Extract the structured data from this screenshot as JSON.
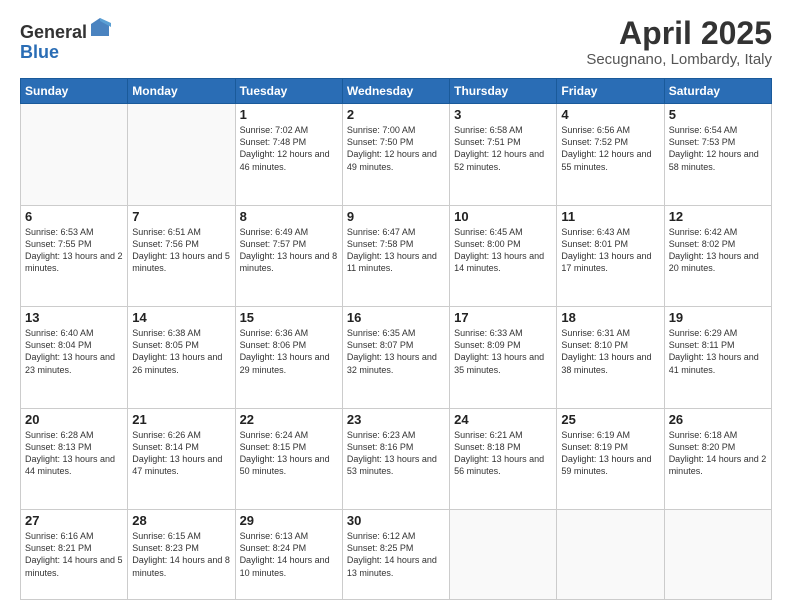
{
  "logo": {
    "general": "General",
    "blue": "Blue"
  },
  "title": "April 2025",
  "subtitle": "Secugnano, Lombardy, Italy",
  "weekdays": [
    "Sunday",
    "Monday",
    "Tuesday",
    "Wednesday",
    "Thursday",
    "Friday",
    "Saturday"
  ],
  "weeks": [
    [
      {
        "day": "",
        "info": ""
      },
      {
        "day": "",
        "info": ""
      },
      {
        "day": "1",
        "info": "Sunrise: 7:02 AM\nSunset: 7:48 PM\nDaylight: 12 hours and 46 minutes."
      },
      {
        "day": "2",
        "info": "Sunrise: 7:00 AM\nSunset: 7:50 PM\nDaylight: 12 hours and 49 minutes."
      },
      {
        "day": "3",
        "info": "Sunrise: 6:58 AM\nSunset: 7:51 PM\nDaylight: 12 hours and 52 minutes."
      },
      {
        "day": "4",
        "info": "Sunrise: 6:56 AM\nSunset: 7:52 PM\nDaylight: 12 hours and 55 minutes."
      },
      {
        "day": "5",
        "info": "Sunrise: 6:54 AM\nSunset: 7:53 PM\nDaylight: 12 hours and 58 minutes."
      }
    ],
    [
      {
        "day": "6",
        "info": "Sunrise: 6:53 AM\nSunset: 7:55 PM\nDaylight: 13 hours and 2 minutes."
      },
      {
        "day": "7",
        "info": "Sunrise: 6:51 AM\nSunset: 7:56 PM\nDaylight: 13 hours and 5 minutes."
      },
      {
        "day": "8",
        "info": "Sunrise: 6:49 AM\nSunset: 7:57 PM\nDaylight: 13 hours and 8 minutes."
      },
      {
        "day": "9",
        "info": "Sunrise: 6:47 AM\nSunset: 7:58 PM\nDaylight: 13 hours and 11 minutes."
      },
      {
        "day": "10",
        "info": "Sunrise: 6:45 AM\nSunset: 8:00 PM\nDaylight: 13 hours and 14 minutes."
      },
      {
        "day": "11",
        "info": "Sunrise: 6:43 AM\nSunset: 8:01 PM\nDaylight: 13 hours and 17 minutes."
      },
      {
        "day": "12",
        "info": "Sunrise: 6:42 AM\nSunset: 8:02 PM\nDaylight: 13 hours and 20 minutes."
      }
    ],
    [
      {
        "day": "13",
        "info": "Sunrise: 6:40 AM\nSunset: 8:04 PM\nDaylight: 13 hours and 23 minutes."
      },
      {
        "day": "14",
        "info": "Sunrise: 6:38 AM\nSunset: 8:05 PM\nDaylight: 13 hours and 26 minutes."
      },
      {
        "day": "15",
        "info": "Sunrise: 6:36 AM\nSunset: 8:06 PM\nDaylight: 13 hours and 29 minutes."
      },
      {
        "day": "16",
        "info": "Sunrise: 6:35 AM\nSunset: 8:07 PM\nDaylight: 13 hours and 32 minutes."
      },
      {
        "day": "17",
        "info": "Sunrise: 6:33 AM\nSunset: 8:09 PM\nDaylight: 13 hours and 35 minutes."
      },
      {
        "day": "18",
        "info": "Sunrise: 6:31 AM\nSunset: 8:10 PM\nDaylight: 13 hours and 38 minutes."
      },
      {
        "day": "19",
        "info": "Sunrise: 6:29 AM\nSunset: 8:11 PM\nDaylight: 13 hours and 41 minutes."
      }
    ],
    [
      {
        "day": "20",
        "info": "Sunrise: 6:28 AM\nSunset: 8:13 PM\nDaylight: 13 hours and 44 minutes."
      },
      {
        "day": "21",
        "info": "Sunrise: 6:26 AM\nSunset: 8:14 PM\nDaylight: 13 hours and 47 minutes."
      },
      {
        "day": "22",
        "info": "Sunrise: 6:24 AM\nSunset: 8:15 PM\nDaylight: 13 hours and 50 minutes."
      },
      {
        "day": "23",
        "info": "Sunrise: 6:23 AM\nSunset: 8:16 PM\nDaylight: 13 hours and 53 minutes."
      },
      {
        "day": "24",
        "info": "Sunrise: 6:21 AM\nSunset: 8:18 PM\nDaylight: 13 hours and 56 minutes."
      },
      {
        "day": "25",
        "info": "Sunrise: 6:19 AM\nSunset: 8:19 PM\nDaylight: 13 hours and 59 minutes."
      },
      {
        "day": "26",
        "info": "Sunrise: 6:18 AM\nSunset: 8:20 PM\nDaylight: 14 hours and 2 minutes."
      }
    ],
    [
      {
        "day": "27",
        "info": "Sunrise: 6:16 AM\nSunset: 8:21 PM\nDaylight: 14 hours and 5 minutes."
      },
      {
        "day": "28",
        "info": "Sunrise: 6:15 AM\nSunset: 8:23 PM\nDaylight: 14 hours and 8 minutes."
      },
      {
        "day": "29",
        "info": "Sunrise: 6:13 AM\nSunset: 8:24 PM\nDaylight: 14 hours and 10 minutes."
      },
      {
        "day": "30",
        "info": "Sunrise: 6:12 AM\nSunset: 8:25 PM\nDaylight: 14 hours and 13 minutes."
      },
      {
        "day": "",
        "info": ""
      },
      {
        "day": "",
        "info": ""
      },
      {
        "day": "",
        "info": ""
      }
    ]
  ]
}
